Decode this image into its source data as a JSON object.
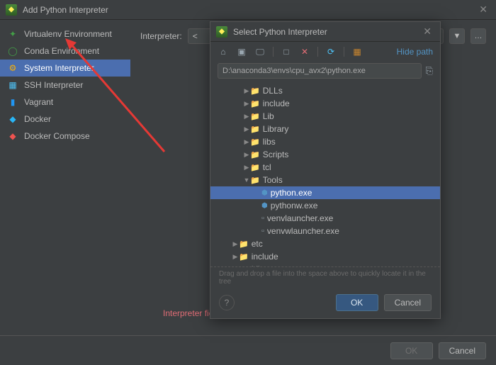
{
  "main": {
    "title": "Add Python Interpreter",
    "interpreter_label": "Interpreter:",
    "interpreter_value": "<",
    "error": "Interpreter field is empty",
    "ok": "OK",
    "cancel": "Cancel"
  },
  "env_types": [
    {
      "label": "Virtualenv Environment",
      "icon": "virtualenv"
    },
    {
      "label": "Conda Environment",
      "icon": "conda"
    },
    {
      "label": "System Interpreter",
      "icon": "system",
      "selected": true
    },
    {
      "label": "SSH Interpreter",
      "icon": "ssh"
    },
    {
      "label": "Vagrant",
      "icon": "vagrant"
    },
    {
      "label": "Docker",
      "icon": "docker"
    },
    {
      "label": "Docker Compose",
      "icon": "compose"
    }
  ],
  "popup": {
    "title": "Select Python Interpreter",
    "hide_path": "Hide path",
    "path": "D:\\anaconda3\\envs\\cpu_avx2\\python.exe",
    "hint": "Drag and drop a file into the space above to quickly locate it in the tree",
    "ok": "OK",
    "cancel": "Cancel",
    "tree": [
      {
        "depth": 1,
        "kind": "folder",
        "chev": "▶",
        "label": "DLLs"
      },
      {
        "depth": 1,
        "kind": "folder",
        "chev": "▶",
        "label": "include"
      },
      {
        "depth": 1,
        "kind": "folder",
        "chev": "▶",
        "label": "Lib"
      },
      {
        "depth": 1,
        "kind": "folder",
        "chev": "▶",
        "label": "Library"
      },
      {
        "depth": 1,
        "kind": "folder",
        "chev": "▶",
        "label": "libs"
      },
      {
        "depth": 1,
        "kind": "folder",
        "chev": "▶",
        "label": "Scripts"
      },
      {
        "depth": 1,
        "kind": "folder",
        "chev": "▶",
        "label": "tcl"
      },
      {
        "depth": 1,
        "kind": "folder",
        "chev": "▼",
        "label": "Tools"
      },
      {
        "depth": 2,
        "kind": "py",
        "label": "python.exe",
        "selected": true
      },
      {
        "depth": 2,
        "kind": "py",
        "label": "pythonw.exe"
      },
      {
        "depth": 2,
        "kind": "file",
        "label": "venvlauncher.exe"
      },
      {
        "depth": 2,
        "kind": "file",
        "label": "venvwlauncher.exe"
      },
      {
        "depth": 0,
        "kind": "folder",
        "chev": "▶",
        "label": "etc"
      },
      {
        "depth": 0,
        "kind": "folder",
        "chev": "▶",
        "label": "include"
      },
      {
        "depth": 0,
        "kind": "folder",
        "chev": "▶",
        "label": "Lib"
      }
    ]
  }
}
